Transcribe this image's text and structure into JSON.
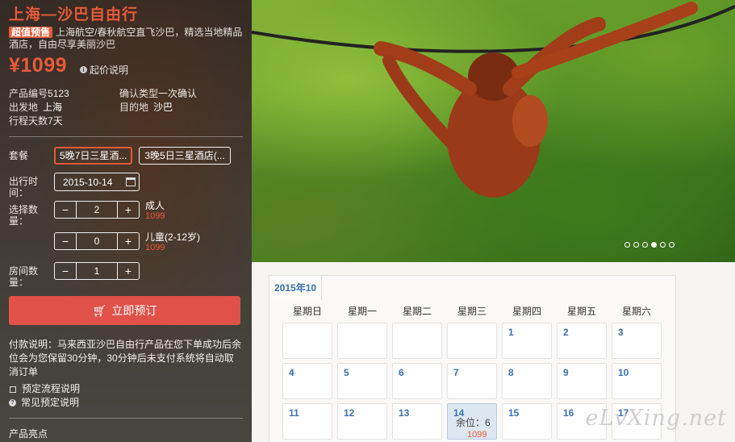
{
  "product": {
    "title": "上海—沙巴自由行",
    "promo_badge": "超值预售",
    "promo_text": "上海航空/春秋航空直飞沙巴，精选当地精品酒店，自由尽享美丽沙巴",
    "price": "¥1099",
    "price_note": "起价说明",
    "info": {
      "code_label": "产品编号",
      "code": "5123",
      "confirm_label": "确认类型",
      "confirm": "一次确认",
      "depart_label": "出发地",
      "depart": "上海",
      "dest_label": "目的地",
      "dest": "沙巴",
      "days_label": "行程天数",
      "days": "7天"
    }
  },
  "form": {
    "package_label": "套餐",
    "packages": [
      "5晚7日三星酒...",
      "3晚5日三星酒店(..."
    ],
    "date_label": "出行时间：",
    "date_value": "2015-10-14",
    "quantity_label": "选择数量：",
    "adult": {
      "value": "2",
      "label": "成人",
      "price": "1099"
    },
    "child": {
      "value": "0",
      "label": "儿童(2-12岁)",
      "price": "1099"
    },
    "rooms_label": "房间数量：",
    "rooms_value": "1",
    "minus": "−",
    "plus": "+",
    "book_button": "立即预订"
  },
  "notes": {
    "payment": "付款说明：马来西亚沙巴自由行产品在您下单成功后余位会为您保留30分钟，30分钟后未支付系统将自动取消订单",
    "flow_link": "预定流程说明",
    "faq_link": "常见预定说明",
    "highlights": "产品亮点"
  },
  "carousel": {
    "count": 6,
    "active_index": 3
  },
  "calendar": {
    "month_tab": "2015年10",
    "weekdays": [
      "星期日",
      "星期一",
      "星期二",
      "星期三",
      "星期四",
      "星期五",
      "星期六"
    ],
    "rows": [
      [
        "",
        "",
        "",
        "",
        "1",
        "2",
        "3"
      ],
      [
        "4",
        "5",
        "6",
        "7",
        "8",
        "9",
        "10"
      ],
      [
        "11",
        "12",
        "13",
        "14",
        "15",
        "16",
        "17"
      ]
    ],
    "selected_day": "14",
    "selected_remaining": "余位：6",
    "selected_price": "1099"
  },
  "watermark": "eLvXing.net",
  "colors": {
    "accent": "#e85a3a",
    "link_blue": "#3a72b0",
    "book_button": "#e0514a"
  }
}
